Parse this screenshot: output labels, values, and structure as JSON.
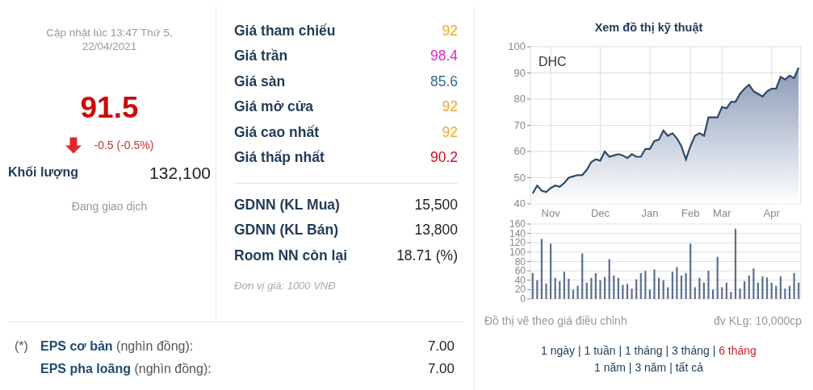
{
  "summary": {
    "updated": "Cập nhật lúc 13:47 Thứ 5, 22/04/2021",
    "price": "91.5",
    "change_down": true,
    "change": "-0.5 (-0.5%)",
    "volume_label": "Khối lượng",
    "volume": "132,100",
    "status": "Đang giao dịch"
  },
  "prices": [
    {
      "label": "Giá tham chiếu",
      "value": "92",
      "color": "#f0a81e"
    },
    {
      "label": "Giá trần",
      "value": "98.4",
      "color": "#e020d0"
    },
    {
      "label": "Giá sàn",
      "value": "85.6",
      "color": "#2c6a92"
    },
    {
      "label": "Giá mở cửa",
      "value": "92",
      "color": "#f0a81e"
    },
    {
      "label": "Giá cao nhất",
      "value": "92",
      "color": "#f0a81e"
    },
    {
      "label": "Giá thấp nhất",
      "value": "90.2",
      "color": "#cc0a1e"
    }
  ],
  "foreign": [
    {
      "label": "GDNN (KL Mua)",
      "value": "15,500"
    },
    {
      "label": "GDNN (KL Bán)",
      "value": "13,800"
    },
    {
      "label": "Room NN còn lại",
      "value": "18.71 (%)"
    }
  ],
  "unit_note": "Đơn vị giá: 1000 VNĐ",
  "eps": [
    {
      "marker": "(*)",
      "label": "EPS cơ bản",
      "unit": "(nghìn đồng):",
      "value": "7.00"
    },
    {
      "label": "EPS pha loãng",
      "unit": "(nghìn đồng):",
      "value": "7.00"
    }
  ],
  "chart_panel": {
    "title": "Xem đồ thị kỹ thuật",
    "price_chart": {
      "chart_data": {
        "type": "area",
        "grid": true,
        "ylim": [
          40,
          100
        ],
        "yticks": [
          40,
          50,
          60,
          70,
          80,
          90,
          100
        ],
        "categories": [
          null,
          null,
          null,
          null,
          "Nov",
          null,
          null,
          null,
          null,
          null,
          null,
          null,
          null,
          null,
          null,
          "Dec",
          null,
          null,
          null,
          null,
          null,
          null,
          null,
          null,
          null,
          null,
          "Jan",
          null,
          null,
          null,
          null,
          null,
          null,
          null,
          null,
          "Feb",
          null,
          null,
          null,
          null,
          null,
          null,
          "Mar",
          null,
          null,
          null,
          null,
          null,
          null,
          null,
          null,
          null,
          null,
          "Apr",
          null,
          null,
          null,
          null,
          null,
          null
        ],
        "series": [
          {
            "name": "DHC",
            "color": "#2e4a66",
            "values": [
              44,
              47,
              45,
              44.5,
              46,
              47,
              46.5,
              48,
              50,
              50.5,
              51,
              51,
              53,
              56,
              57,
              56.5,
              60,
              58,
              58.5,
              59,
              58.5,
              57.5,
              59,
              58,
              58,
              61,
              61,
              64,
              64.5,
              68,
              66,
              67,
              65,
              62,
              57,
              62,
              66,
              67,
              66,
              73,
              73,
              73,
              77,
              76.5,
              79,
              79,
              82,
              84,
              85.5,
              83,
              82,
              81,
              83,
              84,
              84,
              88.5,
              87.5,
              89,
              88,
              92
            ]
          }
        ]
      }
    },
    "volume_chart": {
      "chart_data": {
        "type": "bar",
        "grid": true,
        "ylim": [
          0,
          160
        ],
        "yticks": [
          0,
          20,
          40,
          60,
          80,
          100,
          120,
          140,
          160
        ],
        "series": [
          {
            "color": "#5a6f8f",
            "values": [
              55,
              40,
              128,
              33,
              118,
              45,
              38,
              58,
              43,
              20,
              28,
              97,
              35,
              45,
              55,
              40,
              47,
              85,
              50,
              45,
              30,
              32,
              22,
              42,
              55,
              60,
              20,
              63,
              45,
              40,
              25,
              58,
              68,
              50,
              55,
              118,
              25,
              45,
              35,
              60,
              20,
              90,
              25,
              35,
              15,
              150,
              22,
              38,
              50,
              65,
              35,
              48,
              46,
              35,
              28,
              48,
              22,
              28,
              55,
              35
            ]
          }
        ]
      }
    },
    "note": "Đồ thị vẽ theo giá điều chỉnh",
    "volume_unit": "đv KLg: 10,000cp",
    "ranges": [
      {
        "label": "1 ngày",
        "selected": false
      },
      {
        "separator": "|",
        "label": "1 tuần",
        "selected": false
      },
      {
        "separator": "|",
        "label": "1 tháng",
        "selected": false
      },
      {
        "separator": "|",
        "label": "3 tháng",
        "selected": false
      },
      {
        "separator": "|",
        "label": "6 tháng",
        "selected": true
      },
      {
        "label": "1 năm",
        "selected": false
      },
      {
        "separator": "|",
        "label": "3 năm",
        "selected": false
      },
      {
        "separator": "|",
        "label": "tất cả",
        "selected": false
      }
    ]
  }
}
